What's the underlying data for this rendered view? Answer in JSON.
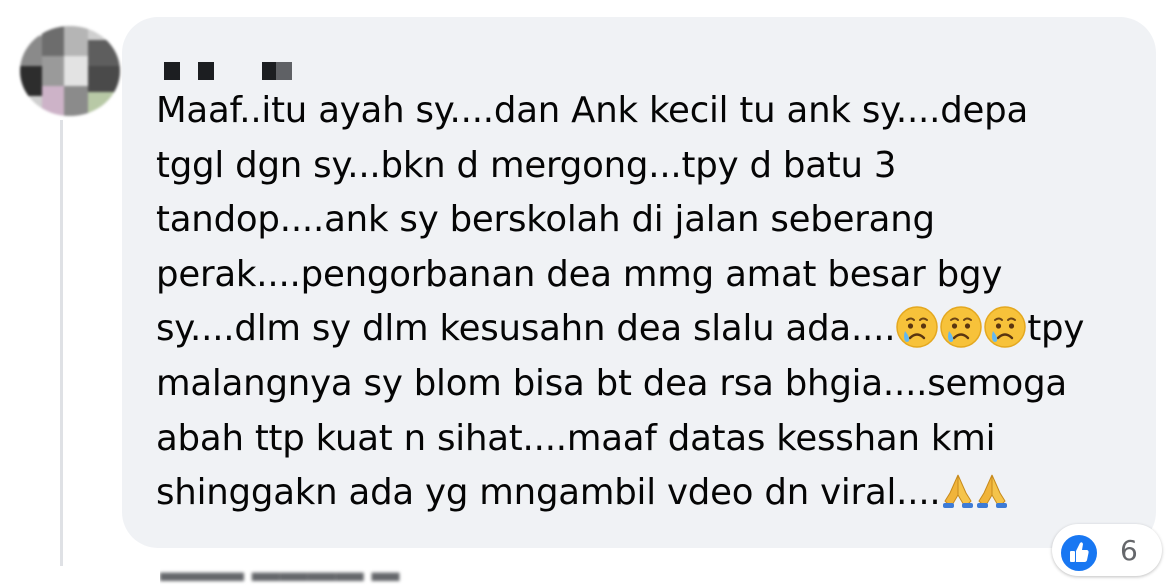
{
  "comment": {
    "author_name": "",
    "lines": [
      {
        "text": "Maaf..itu ayah sy....dan Ank kecil tu ank sy....depa"
      },
      {
        "text": "tggl dgn sy...bkn d mergong...tpy d batu 3"
      },
      {
        "text": "tandop....ank sy berskolah di jalan seberang"
      },
      {
        "text": "perak....pengorbanan dea mmg amat besar bgy"
      },
      {
        "before": "sy....dlm sy dlm kesusahn dea slalu ada....",
        "emoji": [
          "😥",
          "😥",
          "😥"
        ],
        "after": "tpy"
      },
      {
        "text": "malangnya sy blom bisa bt dea rsa bhgia....semoga"
      },
      {
        "text": "abah ttp kuat n sihat....maaf datas kesshan kmi"
      },
      {
        "before": "shinggakn ada yg mngambil vdeo dn viral....",
        "emoji": [
          "🙏",
          "🙏"
        ],
        "after": ""
      }
    ]
  },
  "reactions": {
    "icon": "like-icon",
    "count": "6"
  },
  "colors": {
    "bubble_bg": "#f0f2f5",
    "text": "#050505",
    "like_blue": "#1877f2",
    "secondary_text": "#65676b"
  }
}
